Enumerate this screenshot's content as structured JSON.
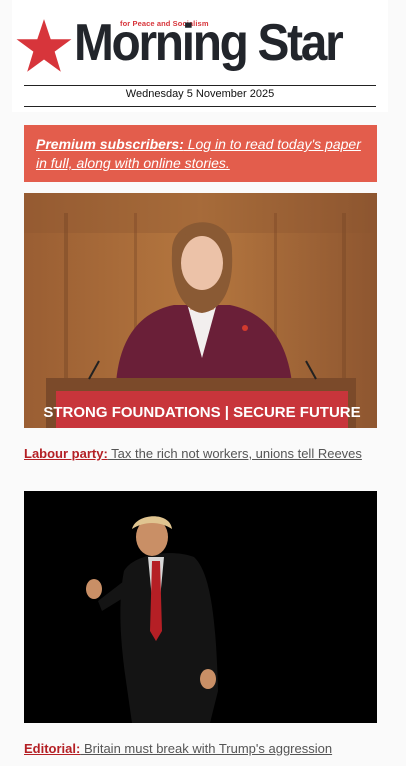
{
  "masthead": {
    "tagline": "for Peace and Socialism",
    "logo_text": "Morning Star",
    "date": "Wednesday 5 November 2025"
  },
  "premium": {
    "strong": "Premium subscribers:",
    "text": " Log in to read today's paper in full, along with online stories."
  },
  "stories": [
    {
      "kicker": "Labour party:",
      "headline": " Tax the rich not workers, unions tell Reeves",
      "podium_sign": "STRONG FOUNDATIONS | SECURE FUTURE"
    },
    {
      "kicker": "Editorial:",
      "headline": " Britain must break with Trump's aggression"
    }
  ],
  "colors": {
    "brand_red": "#d7353b",
    "banner": "#e35d4c",
    "kicker": "#b41f24"
  }
}
